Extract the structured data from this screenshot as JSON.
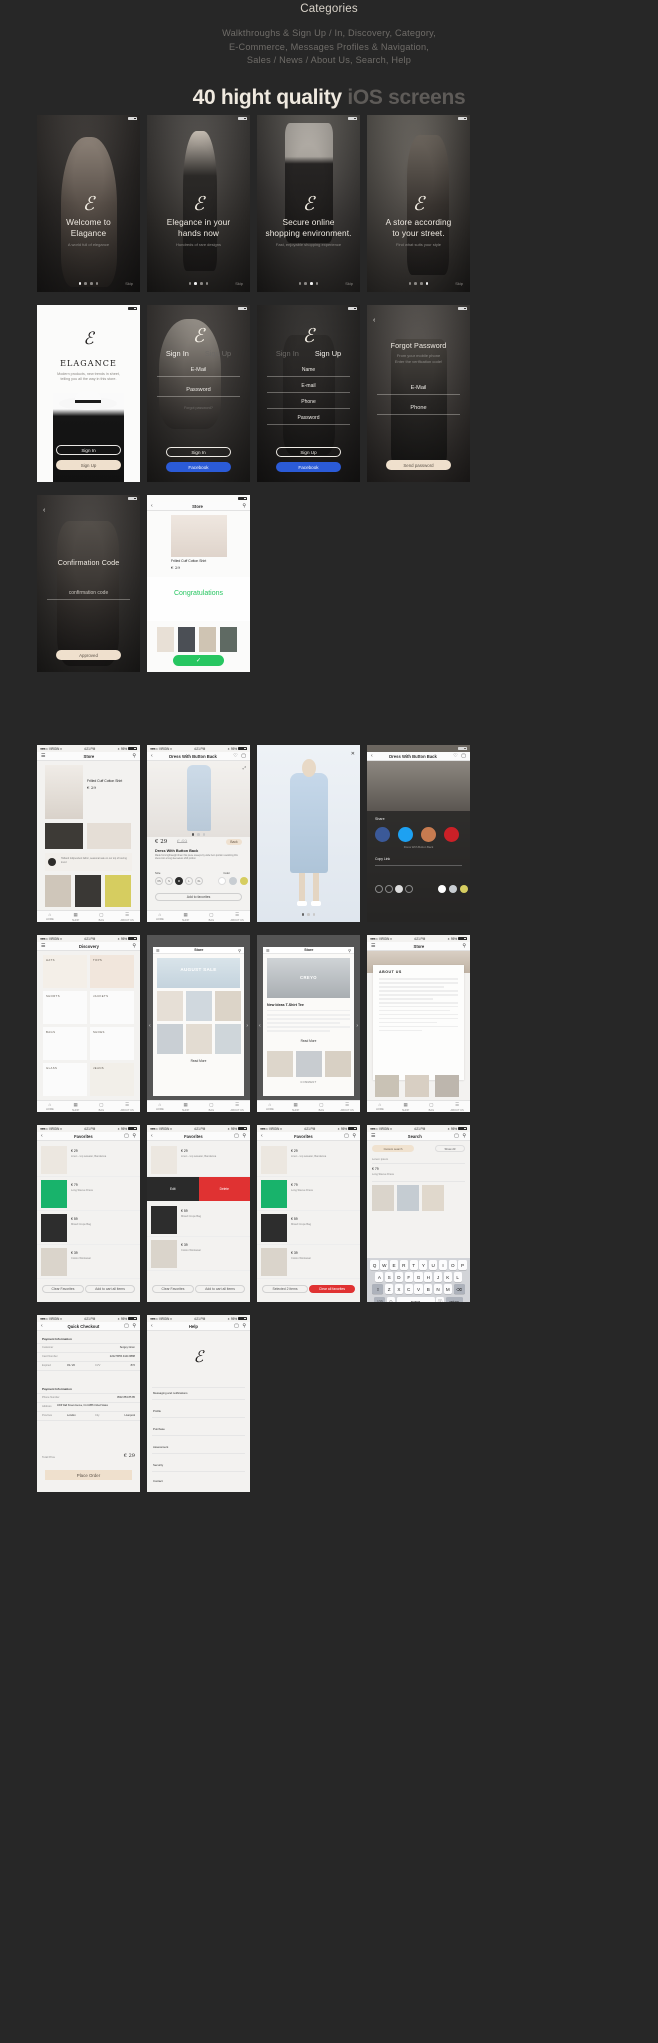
{
  "header": {
    "category_title": "Categories",
    "category_list": [
      "Walkthroughs & Sign Up / In, Discovery, Category,",
      "E-Commerce, Messages Profiles & Navigation,",
      "Sales / News / About Us, Search, Help"
    ],
    "hero_white": "40 hight quality",
    "hero_grey": "iOS screens"
  },
  "status_bar": {
    "carrier": "VIRGIN",
    "dots": "●●●○○",
    "wifi": "▾",
    "time": "4:21 PM",
    "bluetooth": "✶",
    "battery_pct": "95%"
  },
  "walkthroughs": [
    {
      "logo": "ℰ",
      "title": "Welcome to\nElagance",
      "title_l1": "Welcome to",
      "title_l2": "Elagance",
      "desc": "A world full of elegance",
      "skip": "Skip",
      "active_dot": 0
    },
    {
      "title_l1": "Elegance in your",
      "title_l2": "hands now",
      "desc": "Hundreds of rare designs",
      "skip": "Skip",
      "active_dot": 1
    },
    {
      "title_l1": "Secure online",
      "title_l2": "shopping environment.",
      "desc": "Fast, enjoyable shopping experience",
      "skip": "Skip",
      "active_dot": 2
    },
    {
      "title_l1": "A store according",
      "title_l2": "to your street.",
      "desc": "Find what suits your style",
      "skip": "Skip",
      "active_dot": 3
    }
  ],
  "splash": {
    "logo": "ℰ",
    "brand": "ELAGANCE",
    "desc_l1": "Modern products, new trends in sheet,",
    "desc_l2": "telling you all the way in this store.",
    "btn_signin": "Sign In",
    "btn_signup": "Sign Up"
  },
  "signin": {
    "tab_active": "Sign In",
    "tab_inactive": "Sign Up",
    "fields": [
      "E-Mail",
      "Password"
    ],
    "forgot": "Forgot password?",
    "btn_primary": "Sign In",
    "btn_facebook": "Facebook"
  },
  "signup": {
    "tab_inactive": "Sign In",
    "tab_active": "Sign Up",
    "fields": [
      "Name",
      "E-mail",
      "Phone",
      "Password"
    ],
    "btn_primary": "Sign Up",
    "btn_facebook": "Facebook"
  },
  "forgot_password": {
    "back": "‹",
    "title": "Forgot Password",
    "desc_l1": "From your mobile phone",
    "desc_l2": "Enter the verification code!",
    "fields": [
      "E-Mail",
      "Phone"
    ],
    "btn_send": "Send password"
  },
  "confirmation": {
    "back": "‹",
    "title": "Confirmation Code",
    "field": "confirmation code",
    "btn_approve": "Approved"
  },
  "congrats": {
    "back": "‹",
    "nav_title": "Store",
    "message": "Congratulations",
    "product": "Frilled Cuff Cotton Shirt",
    "price": "€ 29",
    "check": "✓"
  },
  "store_home": {
    "nav_title": "Store",
    "menu_icon": "☰",
    "search_icon": "⚲",
    "product_title": "Frilled Cuff Cotton Shirt",
    "price": "€ 29",
    "banner": "Holland Indipendent fabric, seasonal sale on our top of touring trend",
    "tabs": [
      "HOME",
      "SHOP",
      "BAG",
      "ABOUT US"
    ]
  },
  "product": {
    "back": "‹",
    "nav_title": "Dress With Button Back",
    "title": "Dress With Button Back",
    "subtitle": "Made from lightweight linen this piece sweeps by wide hem portion reworking this dress into a long sleeveless shift portion",
    "price": "€ 29  € 69",
    "price_now": "€ 29",
    "price_old": "€ 69",
    "badge": "Back",
    "size_label": "Size",
    "color_label": "Color",
    "sizes": [
      "XS",
      "S",
      "M",
      "L",
      "XL"
    ],
    "btn_add": "Add to favorites",
    "share_icon": "⤴"
  },
  "zoom_view": {
    "close": "✕"
  },
  "share": {
    "back": "‹",
    "nav_title": "Dress With Button Back",
    "share_label": "Share",
    "product": "Dress With Button Back",
    "copy_label": "Copy Link",
    "socials": [
      "facebook",
      "twitter",
      "instagram",
      "pinterest"
    ],
    "colors": {
      "facebook": "#3b5998",
      "twitter": "#1da1f2",
      "instagram": "#c77b50",
      "pinterest": "#cb2027"
    }
  },
  "discovery": {
    "nav_title": "Discovery",
    "categories": [
      "HATS",
      "TOPS",
      "SHORTS",
      "JACKETS",
      "BAGS",
      "SHOES",
      "GLASS",
      "JEANS"
    ],
    "tabs": [
      "HOME",
      "SHOP",
      "BAG",
      "ABOUT US"
    ]
  },
  "sale": {
    "nav_title": "Store",
    "banner_title": "AUGUST SALE",
    "read_more": "Read More",
    "tabs": [
      "HOME",
      "SHOP",
      "BAG",
      "ABOUT US"
    ]
  },
  "news": {
    "nav_title": "Store",
    "brand": "CREYO",
    "title": "New Ideas T-Shirt Tee",
    "read_more": "Read More",
    "comment": "COMMENT",
    "tabs": [
      "HOME",
      "SHOP",
      "BAG",
      "ABOUT US"
    ]
  },
  "about": {
    "nav_title": "Store",
    "title": "ABOUT US",
    "tabs": [
      "HOME",
      "SHOP",
      "BAG",
      "ABOUT US"
    ]
  },
  "favorites": {
    "back": "‹",
    "nav_title": "Favorites",
    "items": [
      {
        "price": "€ 29",
        "name": "Linen - top sweater, Bandanna"
      },
      {
        "price": "€ 79",
        "name": "Long Sleeve Dress"
      },
      {
        "price": "€ 59",
        "name": "Mixed Crepe Bag"
      },
      {
        "price": "€ 39",
        "name": "Cotton Workwear"
      }
    ],
    "btn_clear": "Clear Favorites",
    "btn_add": "Add to cart all items"
  },
  "favorites_swipe": {
    "nav_title": "Favorites",
    "action_edit": "Edit",
    "action_delete": "Delete",
    "btn_clear": "Clear Favorites",
    "btn_add": "Add to cart all items"
  },
  "favorites_select": {
    "nav_title": "Favorites",
    "btn_select": "Selected 2 items",
    "btn_clear_red": "Clear all favorites"
  },
  "search": {
    "nav_title": "Search",
    "placeholder": "Search",
    "chip": "Custom search",
    "btn_filter": "Show 23",
    "rows": [
      "Lorem ipsum",
      "Long Sleeve Dress"
    ],
    "keyboard": {
      "row1": [
        "Q",
        "W",
        "E",
        "R",
        "T",
        "Y",
        "U",
        "I",
        "O",
        "P"
      ],
      "row2": [
        "A",
        "S",
        "D",
        "F",
        "G",
        "H",
        "J",
        "K",
        "L"
      ],
      "row3": [
        "⇧",
        "Z",
        "X",
        "C",
        "V",
        "B",
        "N",
        "M",
        "⌫"
      ],
      "row4": [
        "123",
        "☺",
        "space",
        "ⓘ",
        "return"
      ]
    }
  },
  "checkout": {
    "back": "‹",
    "nav_title": "Quick Checkout",
    "section1": "Payment Information",
    "rows1": [
      {
        "label": "Customer",
        "value": "Sergey Giren"
      },
      {
        "label": "Card Number",
        "value": "2222  5555  4444  8888"
      },
      {
        "label": "Expired",
        "value": "03 / 20",
        "value2": "CVV",
        "value3": "872"
      }
    ],
    "section2": "Payment Information",
    "rows2": [
      {
        "label": "Phone Number",
        "value": "0532 853 85 85"
      },
      {
        "label": "Address",
        "value": "1066 Wall Street Avenue, CA 44885 United States"
      },
      {
        "label": "Province",
        "value": "London",
        "label2": "City",
        "value2": "Liverpool"
      }
    ],
    "total_label": "Total Price",
    "total_value": "€ 29",
    "btn_place": "Place Order"
  },
  "help": {
    "back": "‹",
    "nav_title": "Help",
    "logo": "ℰ",
    "items": [
      "Messaging and notifications",
      "Profile",
      "Purchase",
      "Assessment",
      "Security",
      "Contact"
    ]
  }
}
